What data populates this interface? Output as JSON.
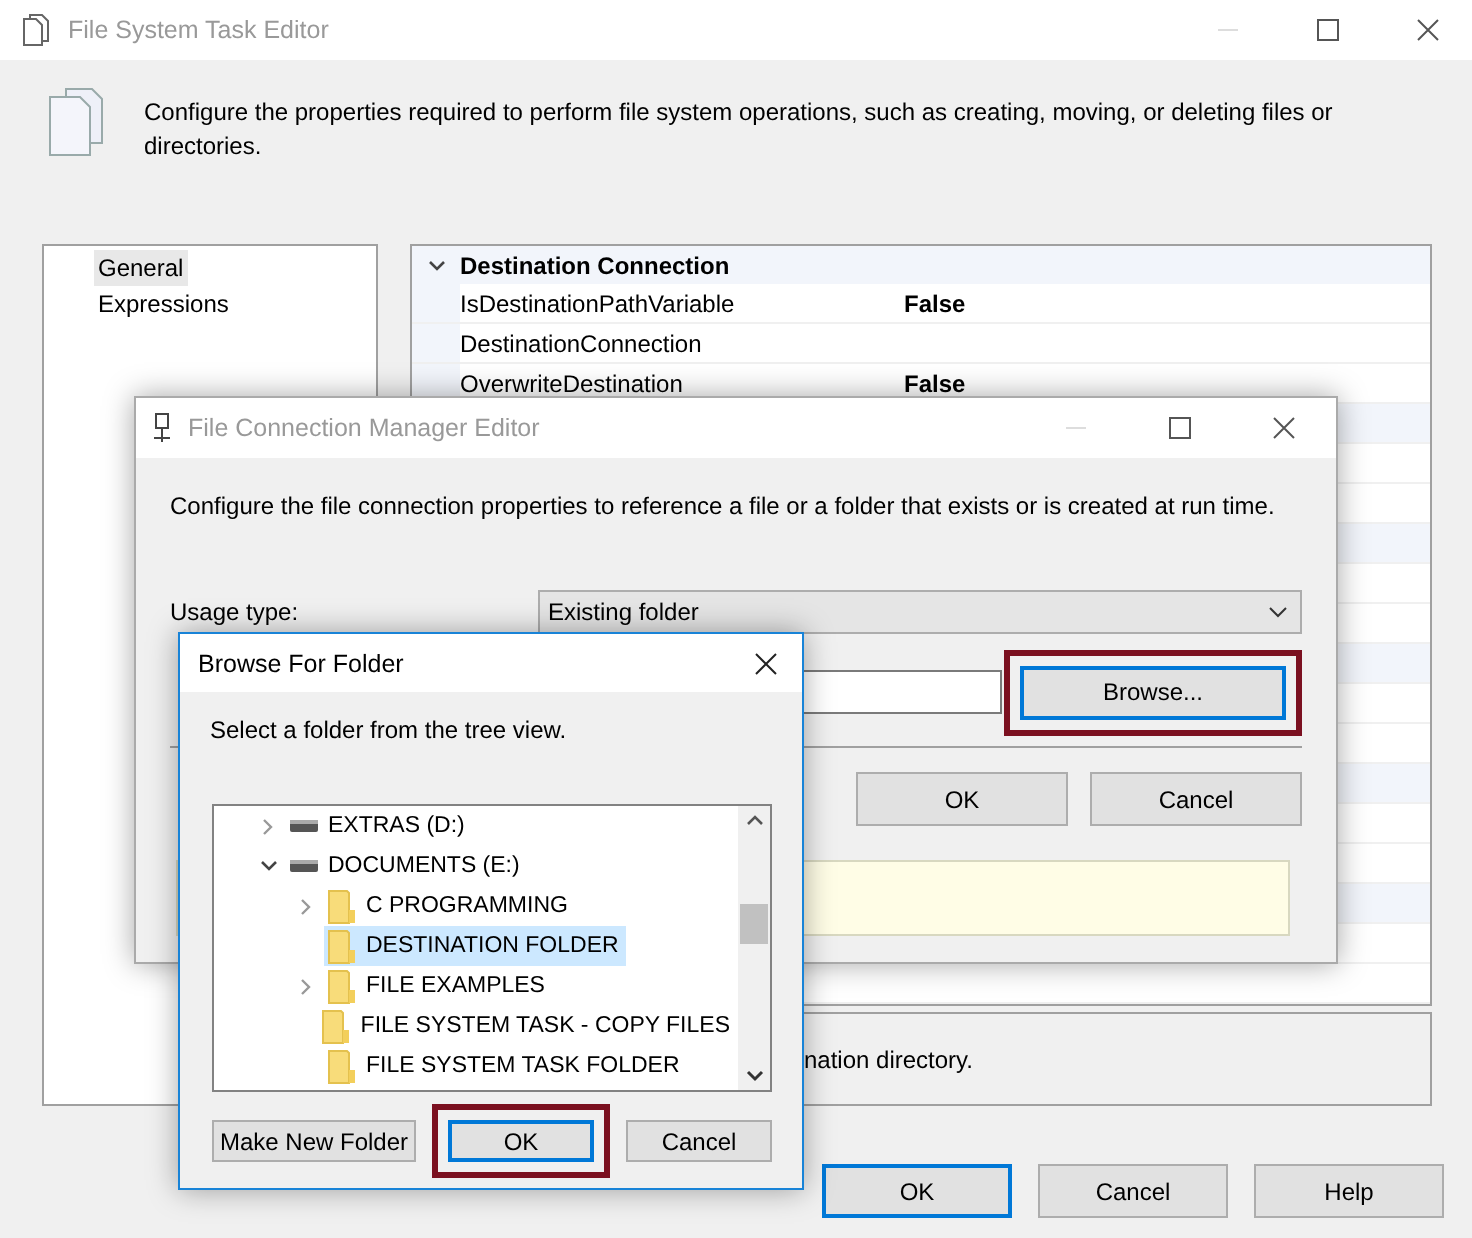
{
  "main_window": {
    "title": "File System Task Editor",
    "description": "Configure the properties required to perform file system operations, such as creating, moving, or deleting files or directories.",
    "nav": [
      {
        "label": "General",
        "selected": true
      },
      {
        "label": "Expressions",
        "selected": false
      }
    ],
    "properties": {
      "category": "Destination Connection",
      "expanded": true,
      "rows": [
        {
          "name": "IsDestinationPathVariable",
          "value": "False"
        },
        {
          "name": "DestinationConnection",
          "value": ""
        },
        {
          "name": "OverwriteDestination",
          "value": "False"
        }
      ]
    },
    "help_text": "nation directory.",
    "buttons": [
      {
        "label": "OK",
        "default": true,
        "highlighted": false
      },
      {
        "label": "Cancel",
        "default": false,
        "highlighted": false
      },
      {
        "label": "Help",
        "default": false,
        "highlighted": false
      }
    ]
  },
  "connection_dialog": {
    "title": "File Connection Manager Editor",
    "description": "Configure the file connection properties to reference a file or a folder that exists or is created at run time.",
    "usage_label": "Usage type:",
    "usage_value": "Existing folder",
    "browse_button": {
      "label": "Browse...",
      "default": true,
      "highlighted": true
    },
    "buttons": [
      {
        "label": "OK",
        "default": false,
        "highlighted": false
      },
      {
        "label": "Cancel",
        "default": false,
        "highlighted": false
      }
    ]
  },
  "browse_dialog": {
    "title": "Browse For Folder",
    "instruction": "Select a folder from the tree view.",
    "tree": [
      {
        "label": "EXTRAS (D:)",
        "kind": "drive",
        "expanded": false,
        "selected": false
      },
      {
        "label": "DOCUMENTS (E:)",
        "kind": "drive",
        "expanded": true,
        "selected": false,
        "children": [
          {
            "label": "C PROGRAMMING",
            "kind": "folder",
            "expanded": false,
            "selected": false
          },
          {
            "label": "DESTINATION FOLDER",
            "kind": "folder",
            "selected": true
          },
          {
            "label": "FILE EXAMPLES",
            "kind": "folder",
            "expanded": false,
            "selected": false
          },
          {
            "label": "FILE SYSTEM TASK - COPY FILES",
            "kind": "folder",
            "selected": false
          },
          {
            "label": "FILE SYSTEM TASK FOLDER",
            "kind": "folder",
            "selected": false
          }
        ]
      }
    ],
    "buttons": [
      {
        "label": "Make New Folder",
        "default": false,
        "highlighted": false
      },
      {
        "label": "OK",
        "default": true,
        "highlighted": true
      },
      {
        "label": "Cancel",
        "default": false,
        "highlighted": false
      }
    ]
  }
}
